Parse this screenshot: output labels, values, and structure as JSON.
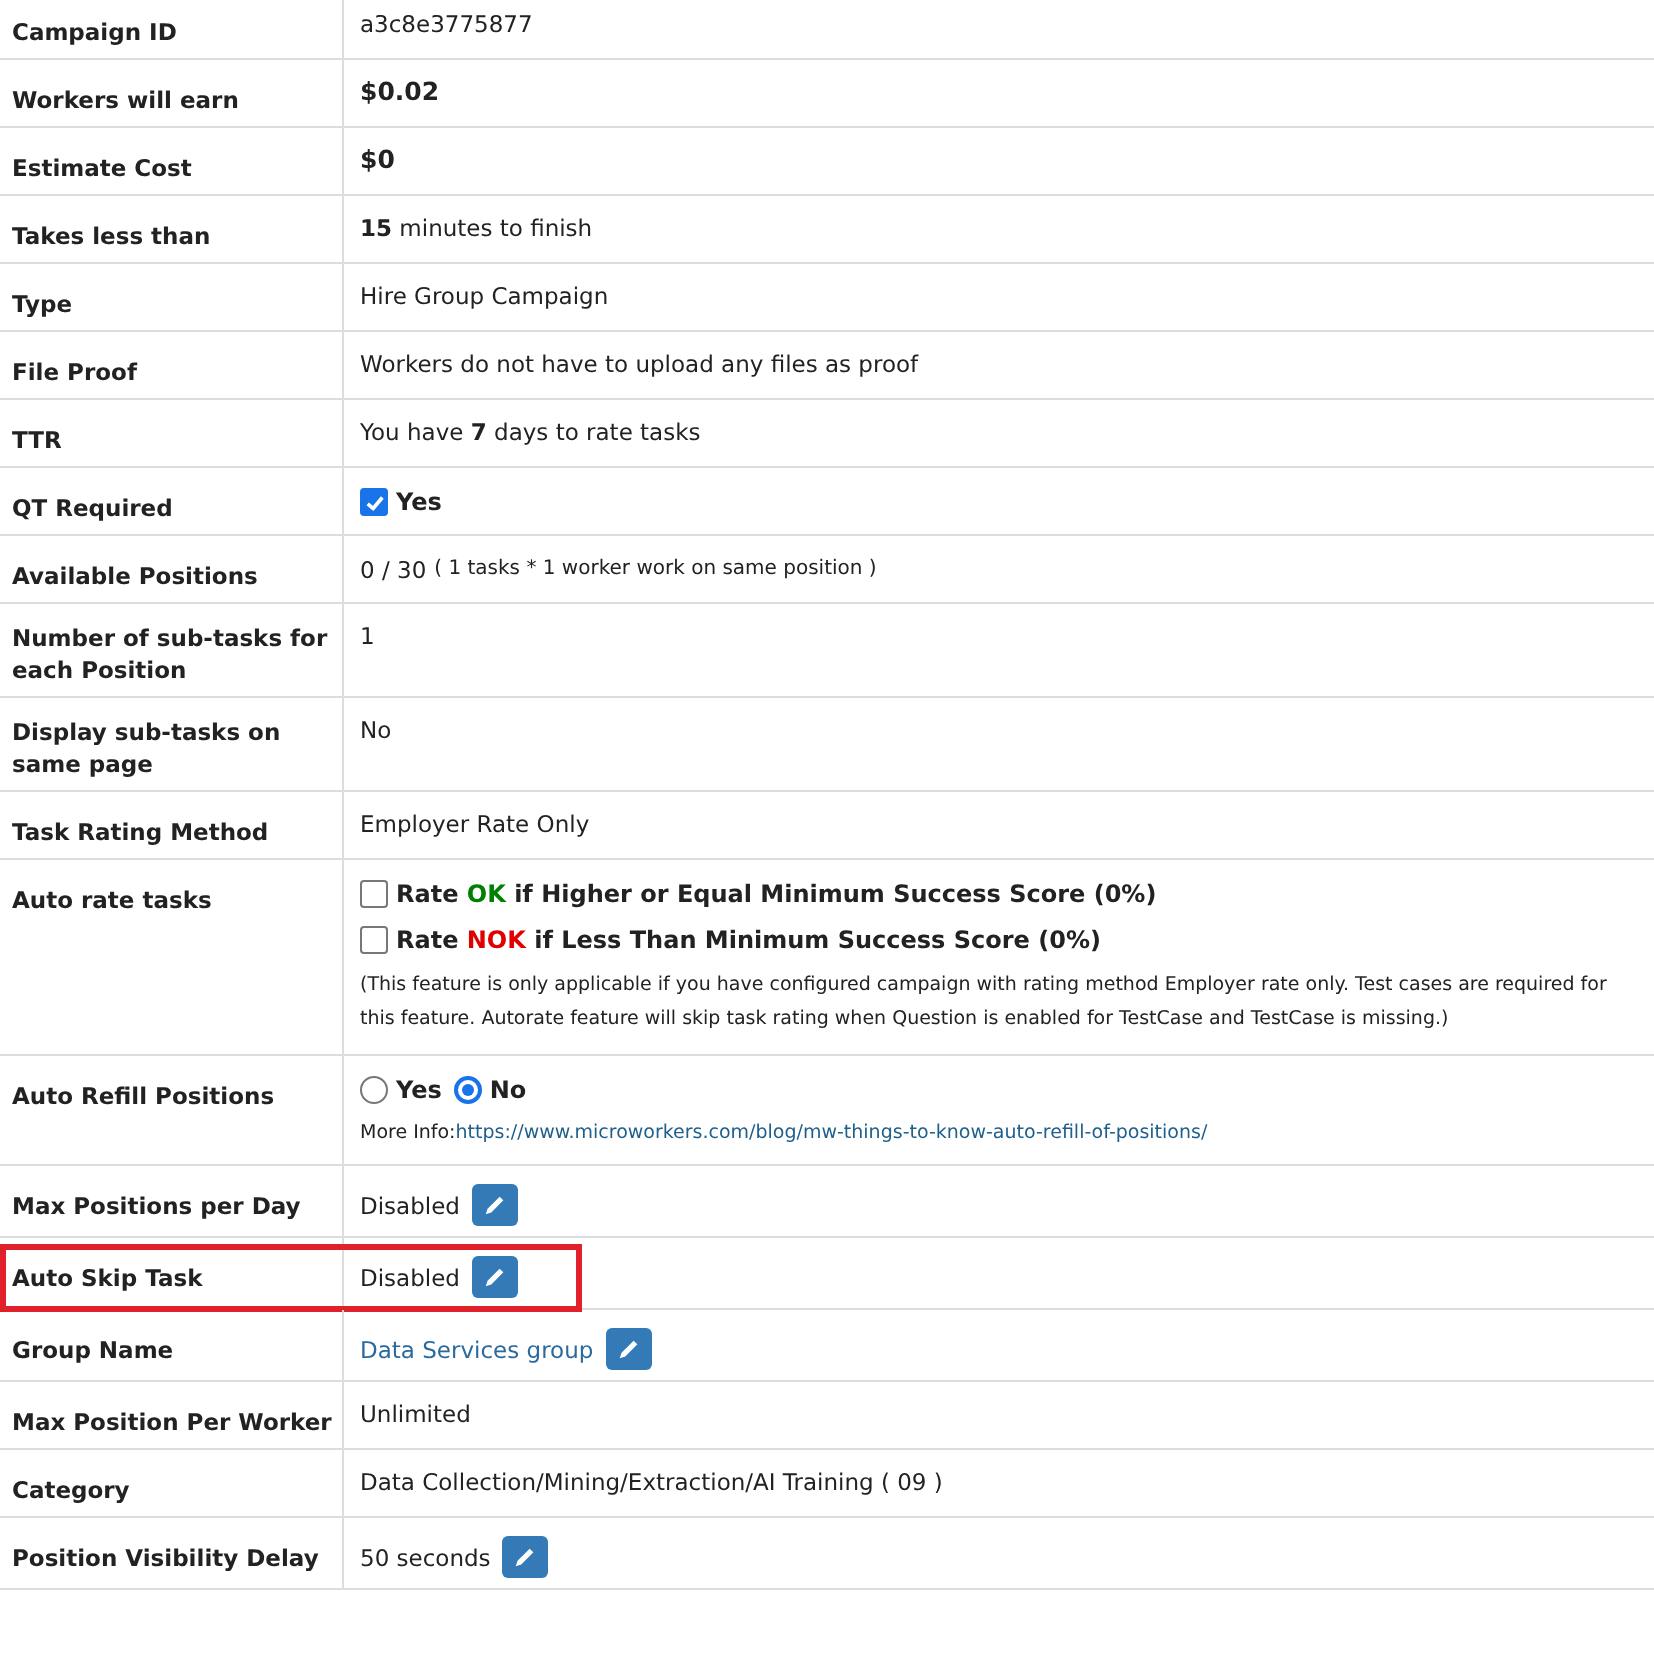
{
  "rows": [
    {
      "label": "Campaign ID",
      "kind": "text",
      "value": "a3c8e3775877"
    },
    {
      "label": "Workers will earn",
      "kind": "amount",
      "value": "$0.02"
    },
    {
      "label": "Estimate Cost",
      "kind": "amount",
      "value": "$0"
    },
    {
      "label": "Takes less than",
      "kind": "text",
      "value": "**15** minutes to finish"
    },
    {
      "label": "Type",
      "kind": "text",
      "value": "Hire Group Campaign"
    },
    {
      "label": "File Proof",
      "kind": "text",
      "value": "Workers do not have to upload any files as proof"
    },
    {
      "label": "TTR",
      "kind": "text",
      "value": "You have **7** days to rate tasks"
    },
    {
      "label": "QT Required",
      "kind": "checkbox",
      "checked": true,
      "value": "Yes"
    },
    {
      "label": "Available Positions",
      "kind": "positions",
      "value": "0 / 30",
      "note": "( 1 tasks * 1 worker work on same position )"
    },
    {
      "label": "Number of sub-tasks for each Position",
      "kind": "text",
      "value": "1"
    },
    {
      "label": "Display sub-tasks on same page",
      "kind": "text",
      "value": "No"
    },
    {
      "label": "Task Rating Method",
      "kind": "text",
      "value": "Employer Rate Only"
    },
    {
      "label": "Auto rate tasks",
      "kind": "checklist",
      "options": [
        {
          "checked": false,
          "prefix": "Rate",
          "tag": "OK",
          "color": "#008000",
          "suffix": "if Higher or Equal Minimum Success Score (0%)"
        },
        {
          "checked": false,
          "prefix": "Rate",
          "tag": "NOK",
          "color": "#e00000",
          "suffix": "if Less Than Minimum Success Score (0%)"
        }
      ],
      "note": "(This feature is only applicable if you have configured campaign with rating method Employer rate only. Test cases are required for this feature. Autorate feature will skip task rating when Question is enabled for TestCase and TestCase is missing.)"
    },
    {
      "label": "Auto Refill Positions",
      "kind": "radio",
      "options": [
        {
          "label": "Yes",
          "selected": false
        },
        {
          "label": "No",
          "selected": true
        }
      ],
      "info_label": "More Info:",
      "link": "https://www.microworkers.com/blog/mw-things-to-know-auto-refill-of-positions/"
    },
    {
      "label": "Max Positions per Day",
      "kind": "editable",
      "value": "Disabled"
    },
    {
      "label": "Auto Skip Task",
      "kind": "editable",
      "value": "Disabled",
      "highlighted": true
    },
    {
      "label": "Group Name",
      "kind": "link_editable",
      "value": "Data Services group"
    },
    {
      "label": "Max Position Per Worker",
      "kind": "text",
      "value": "Unlimited"
    },
    {
      "label": "Category",
      "kind": "text",
      "value": "Data Collection/Mining/Extraction/AI Training ( 09 )"
    },
    {
      "label": "Position Visibility Delay",
      "kind": "editable",
      "value": "50 seconds"
    }
  ]
}
